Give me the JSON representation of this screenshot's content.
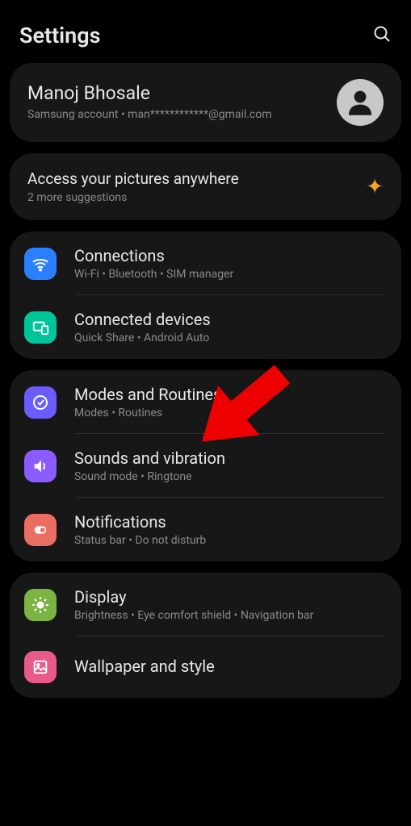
{
  "header": {
    "title": "Settings"
  },
  "profile": {
    "name": "Manoj Bhosale",
    "subtitle": "Samsung account  •  man************@gmail.com"
  },
  "suggestion": {
    "title": "Access your pictures anywhere",
    "sub": "2 more suggestions"
  },
  "groups": [
    {
      "items": [
        {
          "icon": "wifi",
          "iconColor": "blue",
          "title": "Connections",
          "sub": "Wi-Fi  •  Bluetooth  •  SIM manager",
          "divider": true
        },
        {
          "icon": "devices",
          "iconColor": "teal",
          "title": "Connected devices",
          "sub": "Quick Share  •  Android Auto",
          "divider": false
        }
      ]
    },
    {
      "items": [
        {
          "icon": "routines",
          "iconColor": "purple",
          "title": "Modes and Routines",
          "sub": "Modes  •  Routines",
          "divider": true
        },
        {
          "icon": "sound",
          "iconColor": "violet",
          "title": "Sounds and vibration",
          "sub": "Sound mode  •  Ringtone",
          "divider": true
        },
        {
          "icon": "notifications",
          "iconColor": "coral",
          "title": "Notifications",
          "sub": "Status bar  •  Do not disturb",
          "divider": false
        }
      ]
    },
    {
      "items": [
        {
          "icon": "display",
          "iconColor": "green",
          "title": "Display",
          "sub": "Brightness  •  Eye comfort shield  •  Navigation bar",
          "divider": true
        },
        {
          "icon": "wallpaper",
          "iconColor": "pink",
          "title": "Wallpaper and style",
          "sub": "",
          "divider": false
        }
      ]
    }
  ]
}
